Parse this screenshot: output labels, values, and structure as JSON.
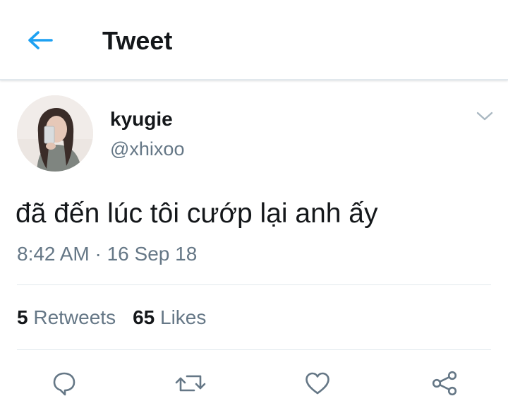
{
  "header": {
    "title": "Tweet",
    "back_icon": "arrow-left-icon"
  },
  "author": {
    "display_name": "kyugie",
    "handle": "@xhixoo",
    "caret_icon": "chevron-down-icon"
  },
  "tweet": {
    "text": "đã đến lúc tôi cướp lại anh ấy",
    "timestamp": "8:42 AM · 16 Sep 18"
  },
  "stats": {
    "retweets_count": "5",
    "retweets_label": "Retweets",
    "likes_count": "65",
    "likes_label": "Likes"
  },
  "actions": [
    "reply-icon",
    "retweet-icon",
    "like-icon",
    "share-icon"
  ],
  "colors": {
    "accent": "#1da1f2",
    "text": "#14171a",
    "muted": "#657786",
    "divider": "#e1e8ed"
  }
}
